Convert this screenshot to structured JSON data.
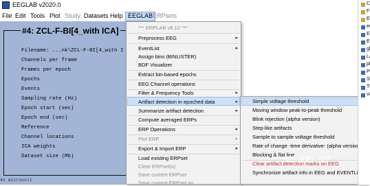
{
  "window": {
    "title": "EEGLAB v2020.0"
  },
  "menubar": [
    "File",
    "Edit",
    "Tools",
    "Plot",
    "Study",
    "Datasets",
    "Help",
    "EEGLAB",
    "ERPsets"
  ],
  "panel": {
    "title": "#4: ZCL-F-BI[4_with ICA]",
    "rows": [
      "Filename: ...nk\\ZCL-F-BI[4_with I",
      "Channels per frame",
      "Frames per epoch",
      "Epochs",
      "Events",
      "Sampling rate (Hz)",
      "Epoch start (sec)",
      "Epoch end (sec)",
      "Reference",
      "Channel locations",
      "ICA weights",
      "Dataset size (Mb)"
    ],
    "status": "4s microvolt"
  },
  "erplab_menu": {
    "items": [
      {
        "label": "*** ERPLAB v8.10 ***",
        "disabled": true
      },
      {
        "label": "Preprocess EEG",
        "submenu": true
      },
      {
        "label": "EventList",
        "submenu": true
      },
      {
        "label": "Assign bins (BINLISTER)"
      },
      {
        "label": "BDF Visualizer"
      },
      {
        "label": "Extract bin-based epochs"
      },
      {
        "label": "EEG Channel operations"
      },
      {
        "label": "Filter & Frequency Tools",
        "submenu": true
      },
      {
        "label": "Artifact detection in epoched data",
        "submenu": true,
        "active": true
      },
      {
        "label": "Summarize artifact detection",
        "submenu": true
      },
      {
        "label": "Compute averaged ERPs"
      },
      {
        "label": "ERP Operations",
        "submenu": true
      },
      {
        "label": "Plot ERP",
        "submenu": true,
        "disabled": true
      },
      {
        "label": "Export & Import ERP",
        "submenu": true
      },
      {
        "label": "Load existing ERPset"
      },
      {
        "label": "Clear ERPset(s)",
        "disabled": true
      },
      {
        "label": "Save current ERPset",
        "disabled": true
      },
      {
        "label": "Save current ERPset as",
        "disabled": true
      }
    ]
  },
  "artifact_submenu": {
    "items": [
      {
        "label": "Simple voltage threshold",
        "active": true
      },
      {
        "label": "Moving window peak-to-peak threshold"
      },
      {
        "label": "Blink rejection (alpha version)"
      },
      {
        "label": "Step-like artifacts"
      },
      {
        "label": "Sample to sample voltage threshold"
      },
      {
        "label": "Rate of change -time derivative- (alpha version)"
      },
      {
        "label": "Blocking & flat line"
      },
      {
        "label": "Clear artifact detection marks on EEG",
        "red": true
      },
      {
        "label": "Synchronize artifact info in EEG and EVENTLIST"
      }
    ]
  },
  "right_panel": {
    "items": [
      "C",
      "F",
      "E",
      "ee",
      "E",
      "E",
      "gl",
      "LA",
      "pl",
      "PL",
      "ST",
      "TM",
      "va"
    ]
  },
  "watermark": "知乎 @某人 电子"
}
